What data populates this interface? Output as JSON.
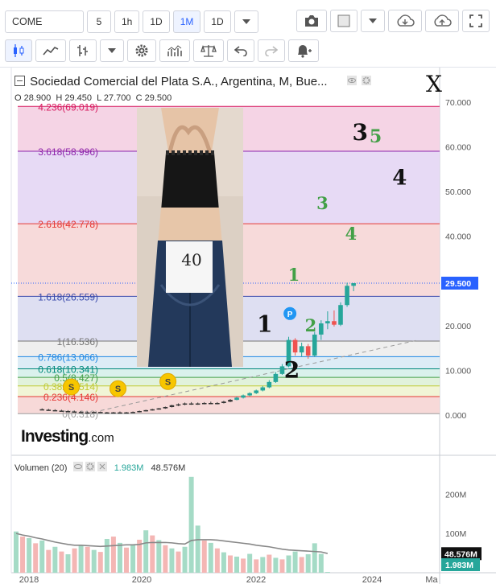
{
  "toolbar": {
    "symbol": "COME",
    "intervals": [
      "5",
      "1h",
      "1D",
      "1M",
      "1D"
    ],
    "active_interval": "1M"
  },
  "legend": {
    "title": "Sociedad Comercial del Plata S.A., Argentina, M, Bue...",
    "open_label": "O",
    "open": "28.900",
    "high_label": "H",
    "high": "29.450",
    "low_label": "L",
    "low": "27.700",
    "close_label": "C",
    "close": "29.500"
  },
  "corner_mark": "X",
  "photo": {
    "sign_text": "40"
  },
  "logo": {
    "main": "Investing",
    "suffix": ".com"
  },
  "volume_legend": {
    "title": "Volumen (20)",
    "current": "1.983M",
    "average": "48.576M"
  },
  "colors": {
    "up": "#26a69a",
    "down": "#ef5350",
    "last_price": "#2962ff",
    "volume_avg": "#888888"
  },
  "chart_data": {
    "type": "candlestick",
    "title": "Sociedad Comercial del Plata S.A., Argentina, M, Bue...",
    "last_price": 29.5,
    "price_axis": {
      "ticks": [
        "70.000",
        "60.000",
        "50.000",
        "40.000",
        "30.000",
        "20.000",
        "10.000",
        "0.000"
      ],
      "ylim": [
        -2,
        72
      ]
    },
    "time_axis": {
      "ticks": [
        "2018",
        "2020",
        "2022",
        "2024",
        "Ma"
      ]
    },
    "fibonacci": [
      {
        "label": "4.236(69.019)",
        "value": 69.019,
        "color": "#d81b60"
      },
      {
        "label": "3.618(58.996)",
        "value": 58.996,
        "color": "#8e24aa"
      },
      {
        "label": "2.618(42.778)",
        "value": 42.778,
        "color": "#e53935"
      },
      {
        "label": "1.618(26.559)",
        "value": 26.559,
        "color": "#3949ab"
      },
      {
        "label": "1(16.536)",
        "value": 16.536,
        "color": "#757575"
      },
      {
        "label": "0.786(13.066)",
        "value": 13.066,
        "color": "#1e88e5"
      },
      {
        "label": "0.618(10.341)",
        "value": 10.341,
        "color": "#00897b"
      },
      {
        "label": "0.5(8.427)",
        "value": 8.427,
        "color": "#43a047"
      },
      {
        "label": "0.382(6.514)",
        "value": 6.514,
        "color": "#c0ca33"
      },
      {
        "label": "0.236(4.146)",
        "value": 4.146,
        "color": "#e53935"
      },
      {
        "label": "0(0.318)",
        "value": 0.318,
        "color": "#9e9e9e"
      }
    ],
    "wave_labels": [
      {
        "text": "3",
        "color": "#111111",
        "t": 53,
        "v": 61.5,
        "size": 28
      },
      {
        "text": "5",
        "color": "#43a047",
        "t": 55.4,
        "v": 61.0,
        "size": 22
      },
      {
        "text": "4",
        "color": "#111111",
        "t": 59.1,
        "v": 51.5,
        "size": 26
      },
      {
        "text": "3",
        "color": "#43a047",
        "t": 47.2,
        "v": 46.0,
        "size": 21
      },
      {
        "text": "4",
        "color": "#43a047",
        "t": 51.6,
        "v": 39.2,
        "size": 21
      },
      {
        "text": "1",
        "color": "#43a047",
        "t": 42.8,
        "v": 30.0,
        "size": 21
      },
      {
        "text": "1",
        "color": "#111111",
        "t": 38.3,
        "v": 18.6,
        "size": 28
      },
      {
        "text": "2",
        "color": "#43a047",
        "t": 45.4,
        "v": 18.7,
        "size": 21
      },
      {
        "text": "2",
        "color": "#111111",
        "t": 42.5,
        "v": 8.4,
        "size": 28
      }
    ],
    "dividend_markers": [
      {
        "label": "S",
        "t": 8.5,
        "v": 6.3
      },
      {
        "label": "S",
        "t": 15.7,
        "v": 5.9
      },
      {
        "label": "S",
        "t": 23.4,
        "v": 7.5
      }
    ],
    "event_marker": {
      "label": "P",
      "t": 42.2,
      "v": 22.7
    },
    "trendline": {
      "from": {
        "t": 13,
        "v": 1.0
      },
      "to": {
        "t": 62,
        "v": 16.8
      }
    },
    "candles": [
      {
        "o": 1.3,
        "h": 1.5,
        "l": 1.1,
        "c": 1.2
      },
      {
        "o": 1.2,
        "h": 1.4,
        "l": 1.0,
        "c": 1.1
      },
      {
        "o": 1.1,
        "h": 1.3,
        "l": 0.9,
        "c": 1.0
      },
      {
        "o": 1.0,
        "h": 1.2,
        "l": 0.8,
        "c": 0.9
      },
      {
        "o": 0.9,
        "h": 1.1,
        "l": 0.7,
        "c": 0.8
      },
      {
        "o": 0.8,
        "h": 1.0,
        "l": 0.6,
        "c": 0.7
      },
      {
        "o": 0.7,
        "h": 0.9,
        "l": 0.5,
        "c": 0.6
      },
      {
        "o": 0.6,
        "h": 0.8,
        "l": 0.5,
        "c": 0.6
      },
      {
        "o": 0.6,
        "h": 0.8,
        "l": 0.5,
        "c": 0.7
      },
      {
        "o": 0.7,
        "h": 0.8,
        "l": 0.5,
        "c": 0.6
      },
      {
        "o": 0.6,
        "h": 0.7,
        "l": 0.4,
        "c": 0.5
      },
      {
        "o": 0.5,
        "h": 0.7,
        "l": 0.4,
        "c": 0.6
      },
      {
        "o": 0.6,
        "h": 0.8,
        "l": 0.5,
        "c": 0.5
      },
      {
        "o": 0.5,
        "h": 0.7,
        "l": 0.4,
        "c": 0.6
      },
      {
        "o": 0.6,
        "h": 0.8,
        "l": 0.5,
        "c": 0.7
      },
      {
        "o": 0.7,
        "h": 1.0,
        "l": 0.6,
        "c": 0.9
      },
      {
        "o": 0.9,
        "h": 1.2,
        "l": 0.8,
        "c": 1.1
      },
      {
        "o": 1.1,
        "h": 1.4,
        "l": 1.0,
        "c": 1.3
      },
      {
        "o": 1.3,
        "h": 1.6,
        "l": 1.2,
        "c": 1.5
      },
      {
        "o": 1.5,
        "h": 1.9,
        "l": 1.4,
        "c": 1.8
      },
      {
        "o": 1.8,
        "h": 2.3,
        "l": 1.7,
        "c": 2.2
      },
      {
        "o": 2.2,
        "h": 2.6,
        "l": 2.0,
        "c": 2.4
      },
      {
        "o": 2.4,
        "h": 2.8,
        "l": 2.2,
        "c": 2.6
      },
      {
        "o": 2.6,
        "h": 2.9,
        "l": 2.3,
        "c": 2.5
      },
      {
        "o": 2.5,
        "h": 2.8,
        "l": 2.3,
        "c": 2.6
      },
      {
        "o": 2.6,
        "h": 2.9,
        "l": 2.4,
        "c": 2.7
      },
      {
        "o": 2.7,
        "h": 3.0,
        "l": 2.5,
        "c": 2.6
      },
      {
        "o": 2.6,
        "h": 2.9,
        "l": 2.4,
        "c": 2.7
      },
      {
        "o": 2.7,
        "h": 3.2,
        "l": 2.6,
        "c": 3.0
      },
      {
        "o": 3.0,
        "h": 3.6,
        "l": 2.9,
        "c": 3.4
      },
      {
        "o": 3.4,
        "h": 4.1,
        "l": 3.3,
        "c": 3.9
      },
      {
        "o": 3.9,
        "h": 4.6,
        "l": 3.7,
        "c": 4.4
      },
      {
        "o": 4.4,
        "h": 5.1,
        "l": 4.2,
        "c": 4.9
      },
      {
        "o": 4.9,
        "h": 5.7,
        "l": 4.7,
        "c": 5.5
      },
      {
        "o": 5.5,
        "h": 6.5,
        "l": 5.3,
        "c": 6.2
      },
      {
        "o": 6.2,
        "h": 7.8,
        "l": 6.0,
        "c": 7.4
      },
      {
        "o": 7.4,
        "h": 9.6,
        "l": 7.2,
        "c": 9.2
      },
      {
        "o": 9.2,
        "h": 11.4,
        "l": 9.0,
        "c": 10.9
      },
      {
        "o": 10.9,
        "h": 17.5,
        "l": 10.7,
        "c": 16.8
      },
      {
        "o": 16.8,
        "h": 17.2,
        "l": 13.3,
        "c": 14.0
      },
      {
        "o": 14.0,
        "h": 16.2,
        "l": 13.1,
        "c": 15.4
      },
      {
        "o": 15.4,
        "h": 15.9,
        "l": 12.6,
        "c": 13.3
      },
      {
        "o": 13.3,
        "h": 18.6,
        "l": 13.0,
        "c": 18.0
      },
      {
        "o": 18.0,
        "h": 21.2,
        "l": 16.8,
        "c": 20.5
      },
      {
        "o": 20.5,
        "h": 23.2,
        "l": 19.2,
        "c": 21.0
      },
      {
        "o": 21.0,
        "h": 23.4,
        "l": 19.8,
        "c": 20.2
      },
      {
        "o": 20.2,
        "h": 25.2,
        "l": 19.9,
        "c": 24.6
      },
      {
        "o": 24.6,
        "h": 29.6,
        "l": 24.2,
        "c": 28.9
      },
      {
        "o": 28.9,
        "h": 29.45,
        "l": 27.7,
        "c": 29.5
      }
    ],
    "volume_axis": {
      "ticks": [
        "200M",
        "100M"
      ],
      "max": 260
    },
    "volume": [
      {
        "v": 105,
        "up": true
      },
      {
        "v": 92,
        "up": false
      },
      {
        "v": 88,
        "up": true
      },
      {
        "v": 75,
        "up": false
      },
      {
        "v": 82,
        "up": true
      },
      {
        "v": 58,
        "up": false
      },
      {
        "v": 66,
        "up": true
      },
      {
        "v": 54,
        "up": false
      },
      {
        "v": 47,
        "up": true
      },
      {
        "v": 62,
        "up": false
      },
      {
        "v": 71,
        "up": true
      },
      {
        "v": 66,
        "up": false
      },
      {
        "v": 58,
        "up": true
      },
      {
        "v": 53,
        "up": false
      },
      {
        "v": 86,
        "up": true
      },
      {
        "v": 92,
        "up": false
      },
      {
        "v": 76,
        "up": true
      },
      {
        "v": 64,
        "up": false
      },
      {
        "v": 70,
        "up": true
      },
      {
        "v": 84,
        "up": false
      },
      {
        "v": 108,
        "up": true
      },
      {
        "v": 95,
        "up": false
      },
      {
        "v": 83,
        "up": true
      },
      {
        "v": 70,
        "up": false
      },
      {
        "v": 62,
        "up": true
      },
      {
        "v": 54,
        "up": false
      },
      {
        "v": 66,
        "up": true
      },
      {
        "v": 244,
        "up": true
      },
      {
        "v": 120,
        "up": true
      },
      {
        "v": 82,
        "up": false
      },
      {
        "v": 76,
        "up": true
      },
      {
        "v": 62,
        "up": false
      },
      {
        "v": 52,
        "up": true
      },
      {
        "v": 44,
        "up": false
      },
      {
        "v": 41,
        "up": true
      },
      {
        "v": 36,
        "up": false
      },
      {
        "v": 48,
        "up": true
      },
      {
        "v": 34,
        "up": false
      },
      {
        "v": 40,
        "up": true
      },
      {
        "v": 46,
        "up": false
      },
      {
        "v": 38,
        "up": true
      },
      {
        "v": 34,
        "up": false
      },
      {
        "v": 44,
        "up": true
      },
      {
        "v": 54,
        "up": true
      },
      {
        "v": 40,
        "up": false
      },
      {
        "v": 47,
        "up": true
      },
      {
        "v": 75,
        "up": true
      },
      {
        "v": 48,
        "up": true
      },
      {
        "v": 1.983,
        "up": true
      }
    ],
    "volume_ma": [
      100,
      96,
      93,
      89,
      86,
      82,
      78,
      75,
      72,
      70,
      70,
      69,
      68,
      67,
      68,
      69,
      70,
      71,
      71,
      72,
      76,
      77,
      77,
      77,
      76,
      74,
      73,
      82,
      84,
      84,
      84,
      83,
      81,
      79,
      77,
      75,
      73,
      70,
      68,
      66,
      63,
      60,
      58,
      57,
      56,
      55,
      54,
      53,
      49
    ]
  }
}
